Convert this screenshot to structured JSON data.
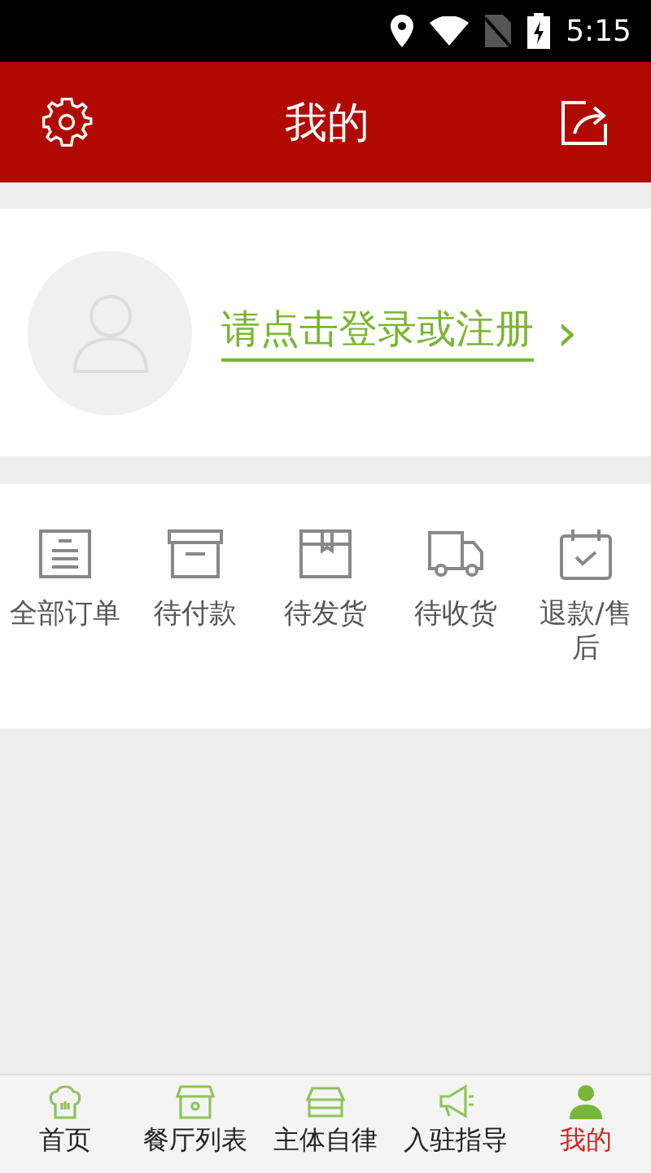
{
  "status_bar": {
    "time": "5:15"
  },
  "header": {
    "title": "我的"
  },
  "login": {
    "prompt": "请点击登录或注册",
    "chevron": "›"
  },
  "orders": [
    {
      "kind": "all",
      "label": "全部订单"
    },
    {
      "kind": "pay",
      "label": "待付款"
    },
    {
      "kind": "ship",
      "label": "待发货"
    },
    {
      "kind": "receive",
      "label": "待收货"
    },
    {
      "kind": "refund",
      "label": "退款/售后"
    }
  ],
  "tab_bar": [
    {
      "kind": "home",
      "label": "首页",
      "selected": false
    },
    {
      "kind": "shop",
      "label": "餐厅列表",
      "selected": false
    },
    {
      "kind": "store",
      "label": "主体自律",
      "selected": false
    },
    {
      "kind": "horn",
      "label": "入驻指导",
      "selected": false
    },
    {
      "kind": "user",
      "label": "我的",
      "selected": true
    }
  ]
}
